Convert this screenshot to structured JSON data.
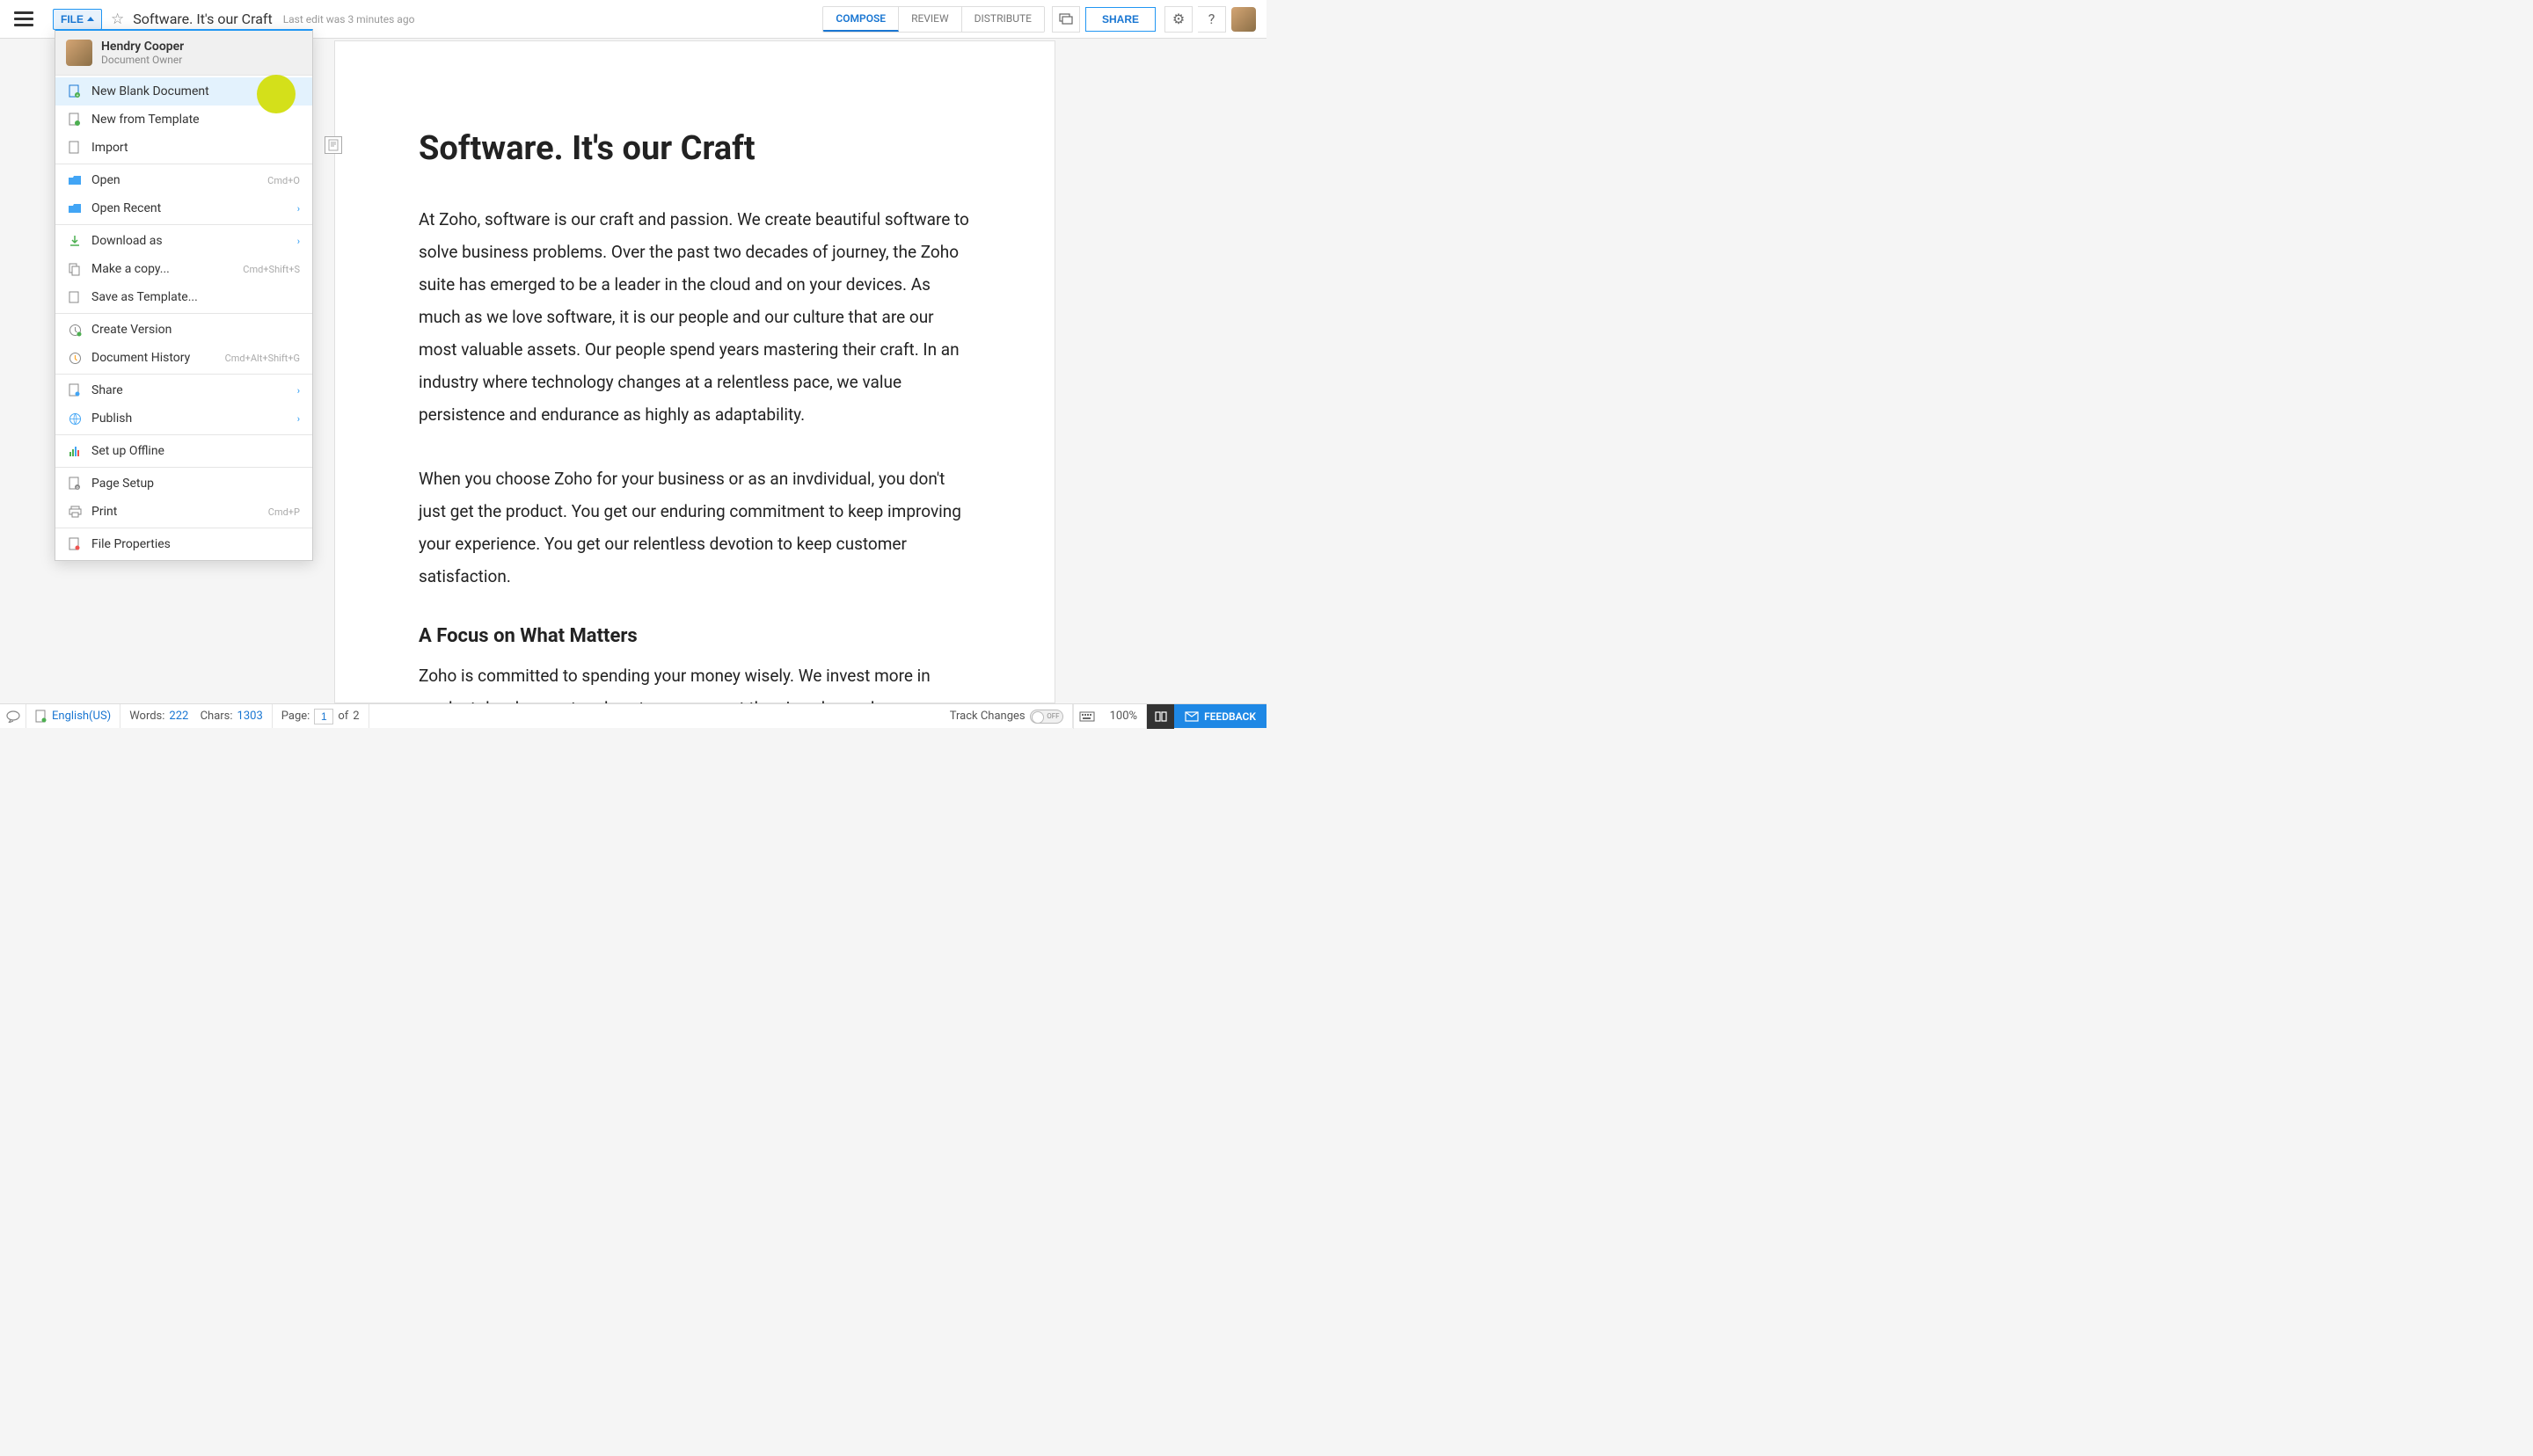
{
  "topbar": {
    "file_label": "FILE",
    "doc_title": "Software. It's our Craft",
    "last_edit": "Last edit was 3 minutes ago",
    "modes": {
      "compose": "COMPOSE",
      "review": "REVIEW",
      "distribute": "DISTRIBUTE"
    },
    "share_label": "SHARE"
  },
  "file_menu": {
    "owner": {
      "name": "Hendry Cooper",
      "role": "Document Owner"
    },
    "items": {
      "new_blank": "New Blank Document",
      "new_template": "New from Template",
      "import": "Import",
      "open": "Open",
      "open_shortcut": "Cmd+O",
      "open_recent": "Open Recent",
      "download_as": "Download as",
      "make_copy": "Make a copy...",
      "make_copy_shortcut": "Cmd+Shift+S",
      "save_template": "Save as Template...",
      "create_version": "Create Version",
      "doc_history": "Document History",
      "doc_history_shortcut": "Cmd+Alt+Shift+G",
      "share": "Share",
      "publish": "Publish",
      "setup_offline": "Set up Offline",
      "page_setup": "Page Setup",
      "print": "Print",
      "print_shortcut": "Cmd+P",
      "file_properties": "File Properties"
    }
  },
  "document": {
    "h1": "Software. It's our Craft",
    "p1": "At Zoho, software is our craft and passion. We create beautiful software to solve business problems. Over the past two decades of  journey, the Zoho suite has emerged to be a leader in the cloud and on your devices.   As much as we love software, it is our people and our culture that are our most valuable assets.   Our people spend years mastering their  craft. In an industry where technology changes at a relentless pace, we value persistence and endurance as highly as adaptability.",
    "p2": "When you choose Zoho for your business  or as an invdividual, you don't just get the product. You get our enduring commitment to keep improving your experience.  You get our relentless devotion to keep customer satisfaction.",
    "h2": "A Focus on What Matters",
    "p3": "Zoho is committed to spending your money wisely. We invest more in product development and customer support than in sales and"
  },
  "statusbar": {
    "language": "English(US)",
    "words_label": "Words:",
    "words_value": "222",
    "chars_label": "Chars:",
    "chars_value": "1303",
    "page_label": "Page:",
    "page_current": "1",
    "page_of": "of",
    "page_total": "2",
    "track_changes_label": "Track Changes",
    "track_changes_state": "OFF",
    "zoom": "100%",
    "feedback_label": "FEEDBACK"
  }
}
